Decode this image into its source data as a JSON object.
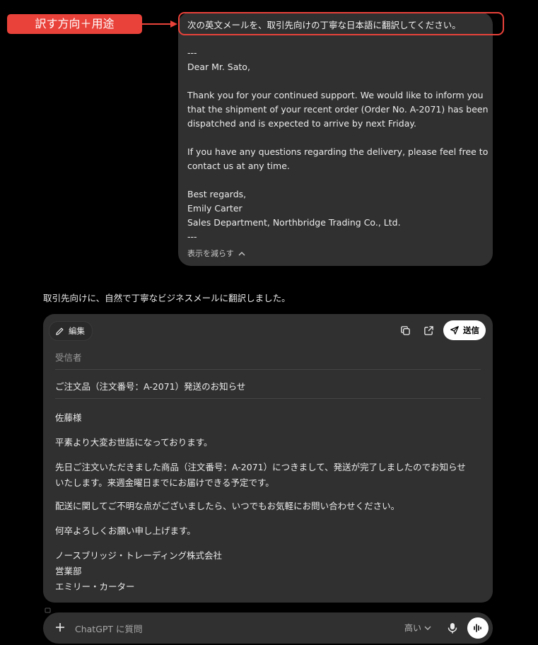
{
  "annotation": {
    "label": "訳す方向＋用途",
    "color": "#e9423a"
  },
  "user_message": {
    "request": "次の英文メールを、取引先向けの丁寧な日本語に翻訳してください。",
    "lines": [
      "---",
      "Dear Mr. Sato,",
      "",
      "Thank you for your continued support. We would like to inform you",
      "that the shipment of your recent order (Order No. A-2071) has been",
      "dispatched and is expected to arrive by next Friday.",
      "",
      "If you have any questions regarding the delivery, please feel free to",
      "contact us at any time.",
      "",
      "Best regards,",
      "Emily Carter",
      "Sales Department, Northbridge Trading Co., Ltd.",
      "---"
    ],
    "show_less": "表示を減らす"
  },
  "assistant": {
    "intro": "取引先向けに、自然で丁寧なビジネスメールに翻訳しました。",
    "canvas": {
      "edit_label": "編集",
      "send_label": "送信",
      "recipient_label": "受信者",
      "subject": "ご注文品（注文番号：A-2071）発送のお知らせ",
      "body": [
        "佐藤様",
        "平素より大変お世話になっております。",
        "先日ご注文いただきました商品（注文番号：A-2071）につきまして、発送が完了しましたのでお知らせいたします。来週金曜日までにお届けできる予定です。",
        "配送に関してご不明な点がございましたら、いつでもお気軽にお問い合わせください。",
        "何卒よろしくお願い申し上げます。",
        "ノースブリッジ・トレーディング株式会社\n営業部\nエミリー・カーター"
      ]
    }
  },
  "composer": {
    "placeholder": "ChatGPT に質問",
    "model": "高い"
  },
  "icons": {
    "edit": "pencil-icon",
    "copy": "copy-icon",
    "open": "external-link-icon",
    "send": "paper-plane-icon",
    "plus": "plus-icon",
    "mic": "microphone-icon",
    "voice": "voice-wave-icon",
    "chevron_up": "chevron-up-icon",
    "chevron_down": "chevron-down-icon"
  }
}
